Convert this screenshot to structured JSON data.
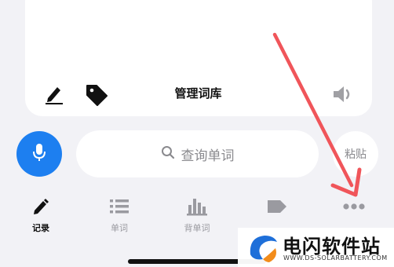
{
  "card": {
    "title": "管理词库",
    "icons": [
      "pencil-icon",
      "tag-icon",
      "speaker-icon"
    ]
  },
  "search": {
    "placeholder": "查询单词",
    "icon": "search-icon"
  },
  "mic_button": {
    "icon": "microphone-icon",
    "color": "#1d7ff0"
  },
  "paste_button": {
    "label": "粘贴"
  },
  "tabs": [
    {
      "label": "记录",
      "icon": "pencil-icon",
      "active": true
    },
    {
      "label": "单词",
      "icon": "list-icon",
      "active": false
    },
    {
      "label": "背单词",
      "icon": "bar-chart-icon",
      "active": false
    },
    {
      "label": "",
      "icon": "tag-icon",
      "active": false
    },
    {
      "label": "",
      "icon": "more-icon",
      "active": false
    }
  ],
  "annotation": {
    "arrow_color": "#f0555a"
  },
  "watermark": {
    "title": "电闪软件站",
    "url": "WWW.DS-SOLARBATTERY.COM"
  }
}
